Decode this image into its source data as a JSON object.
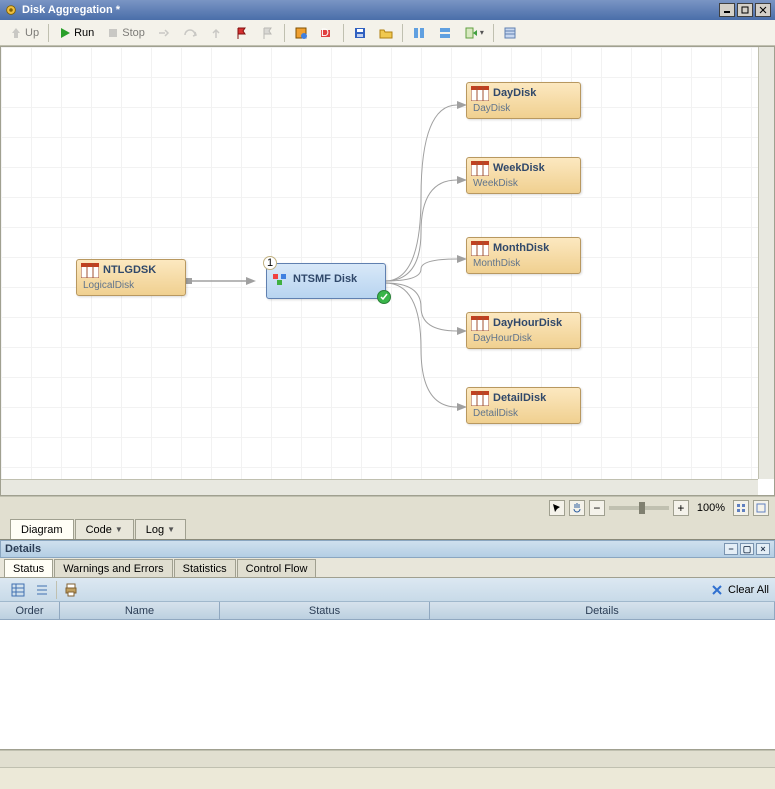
{
  "window": {
    "title": "Disk Aggregation *"
  },
  "toolbar": {
    "up": "Up",
    "run": "Run",
    "stop": "Stop"
  },
  "view_tabs": {
    "diagram": "Diagram",
    "code": "Code",
    "log": "Log"
  },
  "nodes": {
    "src": {
      "title": "NTLGDSK",
      "sub": "LogicalDisk"
    },
    "proc": {
      "title": "NTSMF Disk"
    },
    "out1": {
      "title": "DayDisk",
      "sub": "DayDisk"
    },
    "out2": {
      "title": "WeekDisk",
      "sub": "WeekDisk"
    },
    "out3": {
      "title": "MonthDisk",
      "sub": "MonthDisk"
    },
    "out4": {
      "title": "DayHourDisk",
      "sub": "DayHourDisk"
    },
    "out5": {
      "title": "DetailDisk",
      "sub": "DetailDisk"
    }
  },
  "proc_badge": "1",
  "zoom": {
    "label": "100%"
  },
  "details": {
    "title": "Details",
    "tabs": {
      "status": "Status",
      "warn": "Warnings and Errors",
      "stats": "Statistics",
      "flow": "Control Flow"
    },
    "clear": "Clear All",
    "cols": {
      "order": "Order",
      "name": "Name",
      "status": "Status",
      "details": "Details"
    }
  }
}
